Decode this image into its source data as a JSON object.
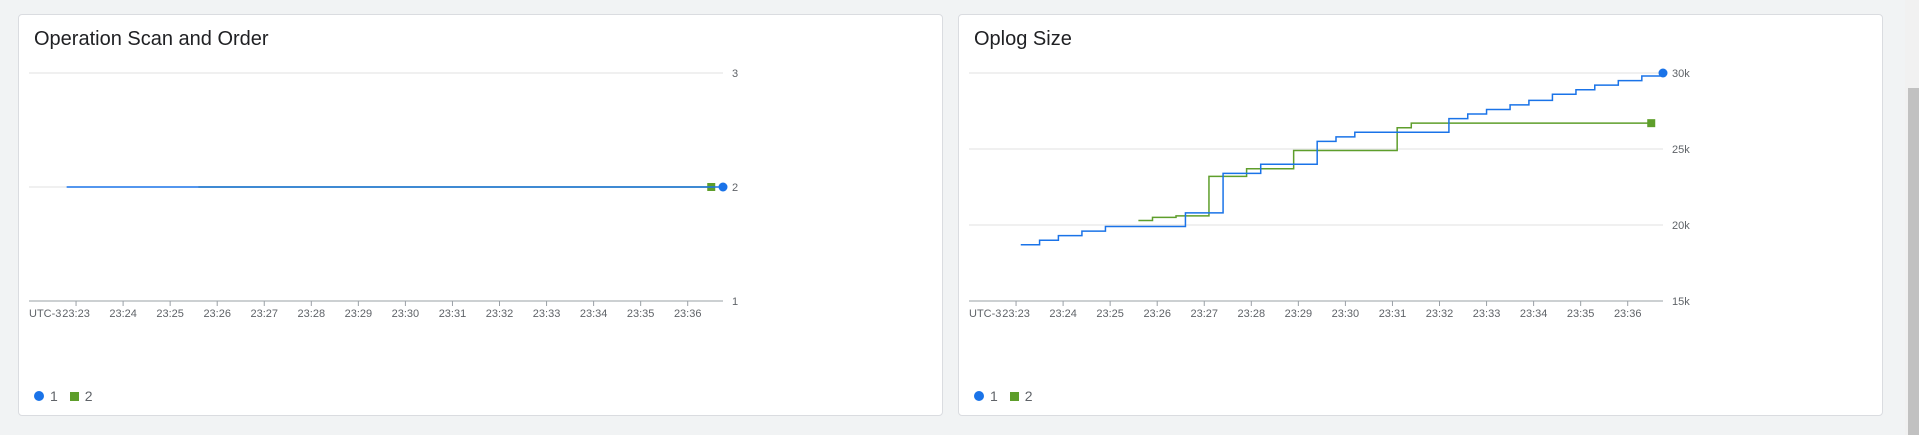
{
  "colors": {
    "series1": "#1a73e8",
    "series2": "#5e9e2b",
    "grid": "#e0e0e0",
    "axis": "#5f6368"
  },
  "chart_data": [
    {
      "type": "line",
      "title": "Operation Scan and Order",
      "timezone": "UTC-3",
      "x_ticks": [
        "23:23",
        "23:24",
        "23:25",
        "23:26",
        "23:27",
        "23:28",
        "23:29",
        "23:30",
        "23:31",
        "23:32",
        "23:33",
        "23:34",
        "23:35",
        "23:36"
      ],
      "xlim": [
        "23:22.0",
        "23:36.75"
      ],
      "y_ticks": [
        "1",
        "2",
        "3"
      ],
      "ylim": [
        1,
        3
      ],
      "y_axis_position": "right",
      "step": true,
      "series": [
        {
          "name": "1",
          "marker": "circle",
          "points": [
            [
              "23:22.8",
              2
            ],
            [
              "23:25.6",
              2
            ],
            [
              "23:36.75",
              2
            ]
          ]
        },
        {
          "name": "2",
          "marker": "square",
          "points": [
            [
              "23:25.6",
              2
            ],
            [
              "23:36.5",
              2
            ]
          ]
        }
      ],
      "legend": {
        "position": "bottom-left",
        "items": [
          "1",
          "2"
        ]
      }
    },
    {
      "type": "line",
      "title": "Oplog Size",
      "timezone": "UTC-3",
      "x_ticks": [
        "23:23",
        "23:24",
        "23:25",
        "23:26",
        "23:27",
        "23:28",
        "23:29",
        "23:30",
        "23:31",
        "23:32",
        "23:33",
        "23:34",
        "23:35",
        "23:36"
      ],
      "xlim": [
        "23:22.0",
        "23:36.75"
      ],
      "y_ticks": [
        "15k",
        "20k",
        "25k",
        "30k"
      ],
      "ylim": [
        15000,
        30000
      ],
      "y_axis_position": "right",
      "step": true,
      "series": [
        {
          "name": "1",
          "marker": "circle",
          "points": [
            [
              "23:23.1",
              18700
            ],
            [
              "23:23.5",
              19000
            ],
            [
              "23:23.9",
              19300
            ],
            [
              "23:24.4",
              19600
            ],
            [
              "23:24.9",
              19900
            ],
            [
              "23:25.5",
              19900
            ],
            [
              "23:26.6",
              20800
            ],
            [
              "23:27.4",
              23400
            ],
            [
              "23:28.2",
              24000
            ],
            [
              "23:28.9",
              24000
            ],
            [
              "23:29.4",
              25500
            ],
            [
              "23:29.8",
              25800
            ],
            [
              "23:30.2",
              26100
            ],
            [
              "23:31.3",
              26100
            ],
            [
              "23:32.2",
              27000
            ],
            [
              "23:32.6",
              27300
            ],
            [
              "23:33.0",
              27600
            ],
            [
              "23:33.5",
              27900
            ],
            [
              "23:33.9",
              28200
            ],
            [
              "23:34.4",
              28600
            ],
            [
              "23:34.9",
              28900
            ],
            [
              "23:35.3",
              29200
            ],
            [
              "23:35.8",
              29500
            ],
            [
              "23:36.3",
              29800
            ],
            [
              "23:36.75",
              30000
            ]
          ]
        },
        {
          "name": "2",
          "marker": "square",
          "points": [
            [
              "23:25.6",
              20300
            ],
            [
              "23:25.9",
              20500
            ],
            [
              "23:26.4",
              20600
            ],
            [
              "23:27.1",
              23200
            ],
            [
              "23:27.9",
              23700
            ],
            [
              "23:28.9",
              24900
            ],
            [
              "23:29.4",
              24900
            ],
            [
              "23:30.9",
              24900
            ],
            [
              "23:31.1",
              26400
            ],
            [
              "23:31.4",
              26700
            ],
            [
              "23:36.5",
              26700
            ]
          ]
        }
      ],
      "legend": {
        "position": "bottom-left",
        "items": [
          "1",
          "2"
        ]
      }
    }
  ]
}
